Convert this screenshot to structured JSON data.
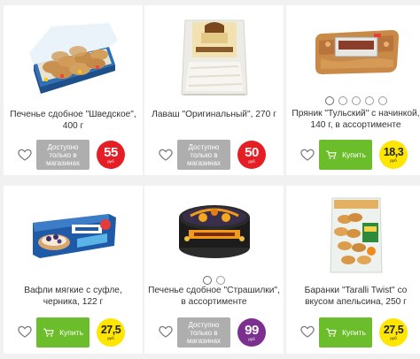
{
  "products": [
    {
      "name": "Печенье сдобное \"Шведское\", 400 г",
      "image": "cookie-box-image",
      "dots": 0,
      "button_type": "unavailable",
      "button_label": "Доступно только в магазинах",
      "price": "55",
      "currency": "руб",
      "price_color": "#e51e25"
    },
    {
      "name": "Лаваш \"Оригинальный\", 270 г",
      "image": "lavash-package-image",
      "dots": 0,
      "button_type": "unavailable",
      "button_label": "Доступно только в магазинах",
      "price": "50",
      "currency": "руб",
      "price_color": "#e51e25"
    },
    {
      "name": "Пряник \"Тульский\" с начинкой, 140 г, в ассортименте",
      "image": "gingerbread-package-image",
      "dots": 5,
      "button_type": "buy",
      "button_label": "Купить",
      "price": "18,3",
      "currency": "руб",
      "price_color": "#ffe600"
    },
    {
      "name": "Вафли мягкие с суфле, черника, 122 г",
      "image": "waffles-package-image",
      "dots": 0,
      "button_type": "buy",
      "button_label": "Купить",
      "price": "27,5",
      "currency": "руб",
      "price_color": "#ffe600"
    },
    {
      "name": "Печенье сдобное \"Страшилки\", в ассортименте",
      "image": "cookie-tin-image",
      "dots": 2,
      "button_type": "unavailable",
      "button_label": "Доступно только в магазинах",
      "price": "99",
      "currency": "руб",
      "price_color": "#7b2f8f"
    },
    {
      "name": "Баранки \"Taralli Twist\" со вкусом апельсина, 250 г",
      "image": "taralli-bag-image",
      "dots": 0,
      "button_type": "buy",
      "button_label": "Купить",
      "price": "27,5",
      "currency": "руб",
      "price_color": "#ffe600"
    }
  ]
}
